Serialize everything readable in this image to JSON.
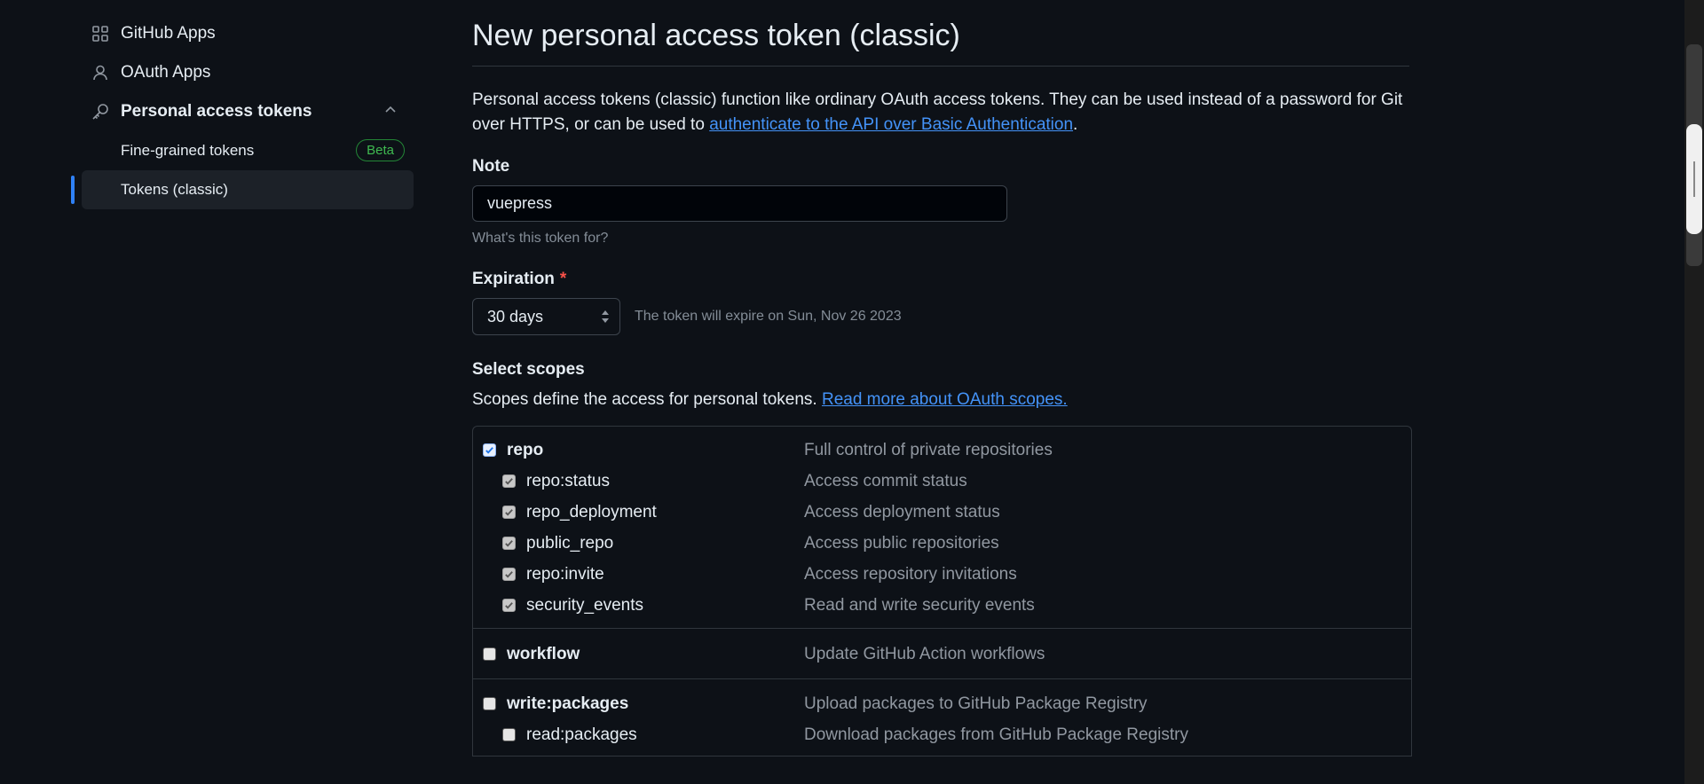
{
  "sidebar": {
    "items": [
      {
        "label": "GitHub Apps",
        "icon": "apps-grid-icon"
      },
      {
        "label": "OAuth Apps",
        "icon": "person-icon"
      },
      {
        "label": "Personal access tokens",
        "icon": "key-icon"
      }
    ],
    "sub_items": [
      {
        "label": "Fine-grained tokens",
        "badge": "Beta"
      },
      {
        "label": "Tokens (classic)"
      }
    ]
  },
  "main": {
    "title": "New personal access token (classic)",
    "intro_text": "Personal access tokens (classic) function like ordinary OAuth access tokens. They can be used instead of a password for Git over HTTPS, or can be used to",
    "intro_link": "authenticate to the API over Basic Authentication",
    "note": {
      "label": "Note",
      "value": "vuepress",
      "hint": "What's this token for?"
    },
    "expiration": {
      "label": "Expiration",
      "required_marker": "*",
      "selected": "30 days",
      "info": "The token will expire on Sun, Nov 26 2023"
    },
    "scopes": {
      "label": "Select scopes",
      "description": "Scopes define the access for personal tokens.",
      "link": "Read more about OAuth scopes.",
      "groups": [
        {
          "name": "repo",
          "desc": "Full control of private repositories",
          "checked": true,
          "children": [
            {
              "name": "repo:status",
              "desc": "Access commit status",
              "checked": true
            },
            {
              "name": "repo_deployment",
              "desc": "Access deployment status",
              "checked": true
            },
            {
              "name": "public_repo",
              "desc": "Access public repositories",
              "checked": true
            },
            {
              "name": "repo:invite",
              "desc": "Access repository invitations",
              "checked": true
            },
            {
              "name": "security_events",
              "desc": "Read and write security events",
              "checked": true
            }
          ]
        },
        {
          "name": "workflow",
          "desc": "Update GitHub Action workflows",
          "checked": false,
          "children": []
        },
        {
          "name": "write:packages",
          "desc": "Upload packages to GitHub Package Registry",
          "checked": false,
          "children": [
            {
              "name": "read:packages",
              "desc": "Download packages from GitHub Package Registry",
              "checked": false
            }
          ]
        }
      ]
    }
  },
  "colors": {
    "background": "#0d1117",
    "link": "#4493f8",
    "accent_bar": "#2f81f7",
    "beta_green": "#3fb950",
    "required_red": "#f85149"
  }
}
